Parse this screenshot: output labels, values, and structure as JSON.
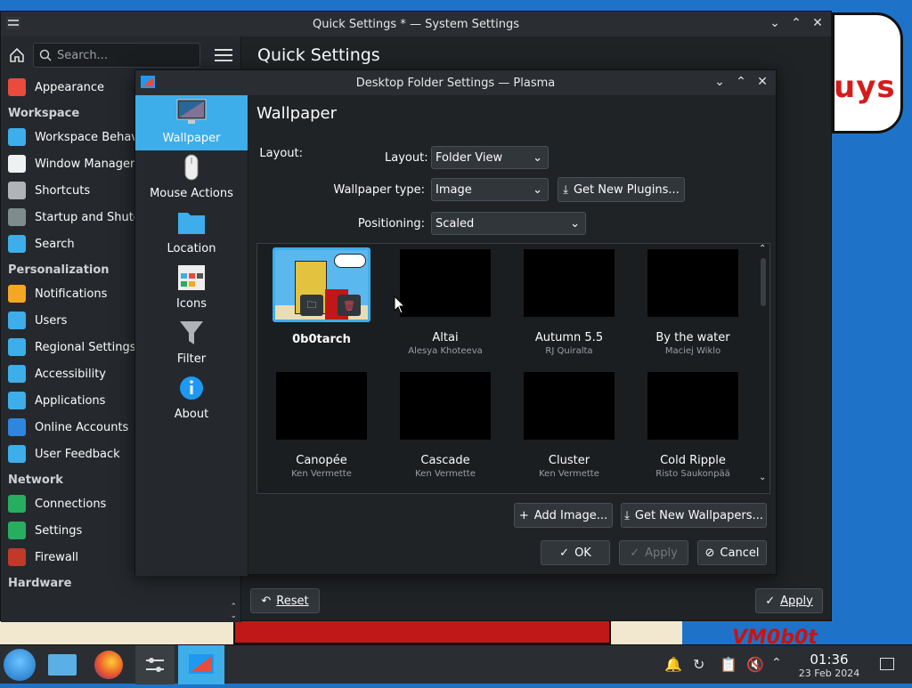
{
  "main_window": {
    "title": "Quick Settings * — System Settings",
    "page_title": "Quick Settings",
    "search_placeholder": "Search...",
    "reset_label": "Reset",
    "apply_label": "Apply"
  },
  "sidebar": {
    "items": [
      {
        "type": "item",
        "label": "Appearance",
        "icon": "appearance-icon",
        "color": "#e94b3c"
      },
      {
        "type": "head",
        "label": "Workspace"
      },
      {
        "type": "item",
        "label": "Workspace Behavior",
        "icon": "workspace-icon",
        "color": "#3daee9"
      },
      {
        "type": "item",
        "label": "Window Management",
        "icon": "window-icon",
        "color": "#eff0f1"
      },
      {
        "type": "item",
        "label": "Shortcuts",
        "icon": "keyboard-icon",
        "color": "#b0b4b8"
      },
      {
        "type": "item",
        "label": "Startup and Shutdown",
        "icon": "startup-icon",
        "color": "#7f8c8d"
      },
      {
        "type": "item",
        "label": "Search",
        "icon": "search-icon",
        "color": "#3daee9"
      },
      {
        "type": "head",
        "label": "Personalization"
      },
      {
        "type": "item",
        "label": "Notifications",
        "icon": "bell-icon",
        "color": "#f5a623"
      },
      {
        "type": "item",
        "label": "Users",
        "icon": "users-icon",
        "color": "#3daee9"
      },
      {
        "type": "item",
        "label": "Regional Settings",
        "icon": "flag-icon",
        "color": "#3daee9"
      },
      {
        "type": "item",
        "label": "Accessibility",
        "icon": "accessibility-icon",
        "color": "#3daee9"
      },
      {
        "type": "item",
        "label": "Applications",
        "icon": "applications-icon",
        "color": "#3daee9"
      },
      {
        "type": "item",
        "label": "Online Accounts",
        "icon": "globe-icon",
        "color": "#2e86de"
      },
      {
        "type": "item",
        "label": "User Feedback",
        "icon": "feedback-icon",
        "color": "#3daee9"
      },
      {
        "type": "head",
        "label": "Network"
      },
      {
        "type": "item",
        "label": "Connections",
        "icon": "connections-icon",
        "color": "#27ae60"
      },
      {
        "type": "item",
        "label": "Settings",
        "icon": "network-settings-icon",
        "color": "#27ae60"
      },
      {
        "type": "item",
        "label": "Firewall",
        "icon": "firewall-icon",
        "color": "#c0392b"
      },
      {
        "type": "head",
        "label": "Hardware"
      }
    ]
  },
  "dialog": {
    "title": "Desktop Folder Settings — Plasma",
    "heading": "Wallpaper",
    "categories": [
      {
        "label": "Wallpaper",
        "icon": "monitor-icon"
      },
      {
        "label": "Mouse Actions",
        "icon": "mouse-icon"
      },
      {
        "label": "Location",
        "icon": "folder-icon"
      },
      {
        "label": "Icons",
        "icon": "icons-icon"
      },
      {
        "label": "Filter",
        "icon": "filter-icon"
      },
      {
        "label": "About",
        "icon": "info-icon"
      }
    ],
    "layout_label": "Layout:",
    "layout_value": "Folder View",
    "wallpaper_type_label": "Wallpaper type:",
    "wallpaper_type_value": "Image",
    "get_plugins_label": "Get New Plugins...",
    "positioning_label": "Positioning:",
    "positioning_value": "Scaled",
    "wallpapers": [
      {
        "name": "0b0tarch",
        "author": ""
      },
      {
        "name": "Altai",
        "author": "Alesya Khoteeva"
      },
      {
        "name": "Autumn 5.5",
        "author": "RJ Quiralta"
      },
      {
        "name": "By the water",
        "author": "Maciej Wiklo"
      },
      {
        "name": "Canopée",
        "author": "Ken Vermette"
      },
      {
        "name": "Cascade",
        "author": "Ken Vermette"
      },
      {
        "name": "Cluster",
        "author": "Ken Vermette"
      },
      {
        "name": "Cold Ripple",
        "author": "Risto Saukonpää"
      }
    ],
    "add_image_label": "Add Image...",
    "get_wallpapers_label": "Get New Wallpapers...",
    "ok_label": "OK",
    "apply_label": "Apply",
    "cancel_label": "Cancel"
  },
  "desktop": {
    "cloud_text": "uys",
    "corner_text": "VM0b0t"
  },
  "taskbar": {
    "time": "01:36",
    "date": "23 Feb 2024"
  }
}
